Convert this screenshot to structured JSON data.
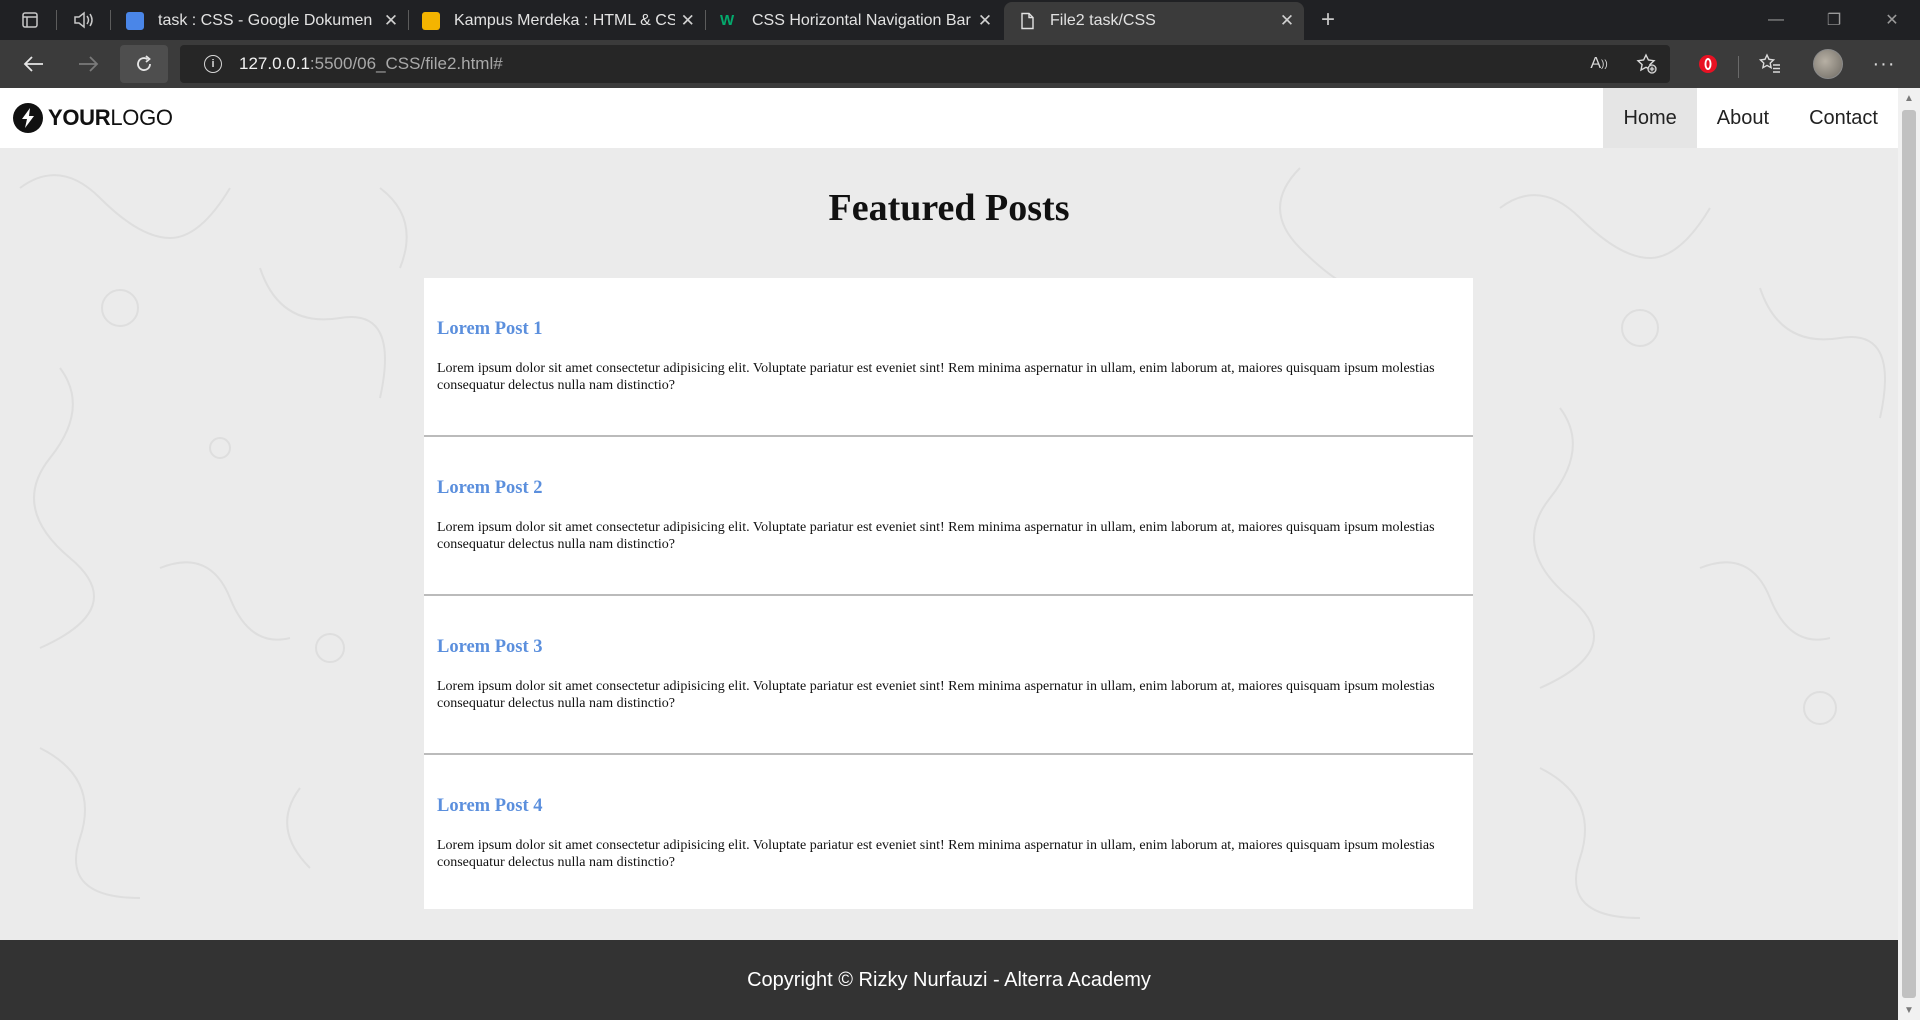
{
  "browser": {
    "tabs": [
      {
        "title": "task : CSS - Google Dokumen",
        "favicon_color": "#4a86e8",
        "active": false
      },
      {
        "title": "Kampus Merdeka : HTML & CSS",
        "favicon_color": "#f4b400",
        "active": false
      },
      {
        "title": "CSS Horizontal Navigation Bar",
        "favicon_color": "#04aa6d",
        "active": false
      },
      {
        "title": "File2 task/CSS",
        "favicon_color": "#e2e2e2",
        "active": true
      }
    ],
    "address": {
      "host": "127.0.0.1",
      "path": ":5500/06_CSS/file2.html#"
    }
  },
  "site": {
    "logo": {
      "bold": "YOUR",
      "regular": "LOGO"
    },
    "menu": [
      {
        "label": "Home",
        "active": true
      },
      {
        "label": "About",
        "active": false
      },
      {
        "label": "Contact",
        "active": false
      }
    ],
    "heading": "Featured Posts",
    "posts": [
      {
        "title": "Lorem Post 1",
        "body": "Lorem ipsum dolor sit amet consectetur adipisicing elit. Voluptate pariatur est eveniet sint! Rem minima aspernatur in ullam, enim laborum at, maiores quisquam ipsum molestias consequatur delectus nulla nam distinctio?"
      },
      {
        "title": "Lorem Post 2",
        "body": "Lorem ipsum dolor sit amet consectetur adipisicing elit. Voluptate pariatur est eveniet sint! Rem minima aspernatur in ullam, enim laborum at, maiores quisquam ipsum molestias consequatur delectus nulla nam distinctio?"
      },
      {
        "title": "Lorem Post 3",
        "body": "Lorem ipsum dolor sit amet consectetur adipisicing elit. Voluptate pariatur est eveniet sint! Rem minima aspernatur in ullam, enim laborum at, maiores quisquam ipsum molestias consequatur delectus nulla nam distinctio?"
      },
      {
        "title": "Lorem Post 4",
        "body": "Lorem ipsum dolor sit amet consectetur adipisicing elit. Voluptate pariatur est eveniet sint! Rem minima aspernatur in ullam, enim laborum at, maiores quisquam ipsum molestias consequatur delectus nulla nam distinctio?"
      }
    ],
    "footer": "Copyright © Rizky Nurfauzi - Alterra Academy"
  },
  "colors": {
    "post_title": "#5b8fdd",
    "page_background": "#ebebeb",
    "footer_background": "#333333"
  }
}
